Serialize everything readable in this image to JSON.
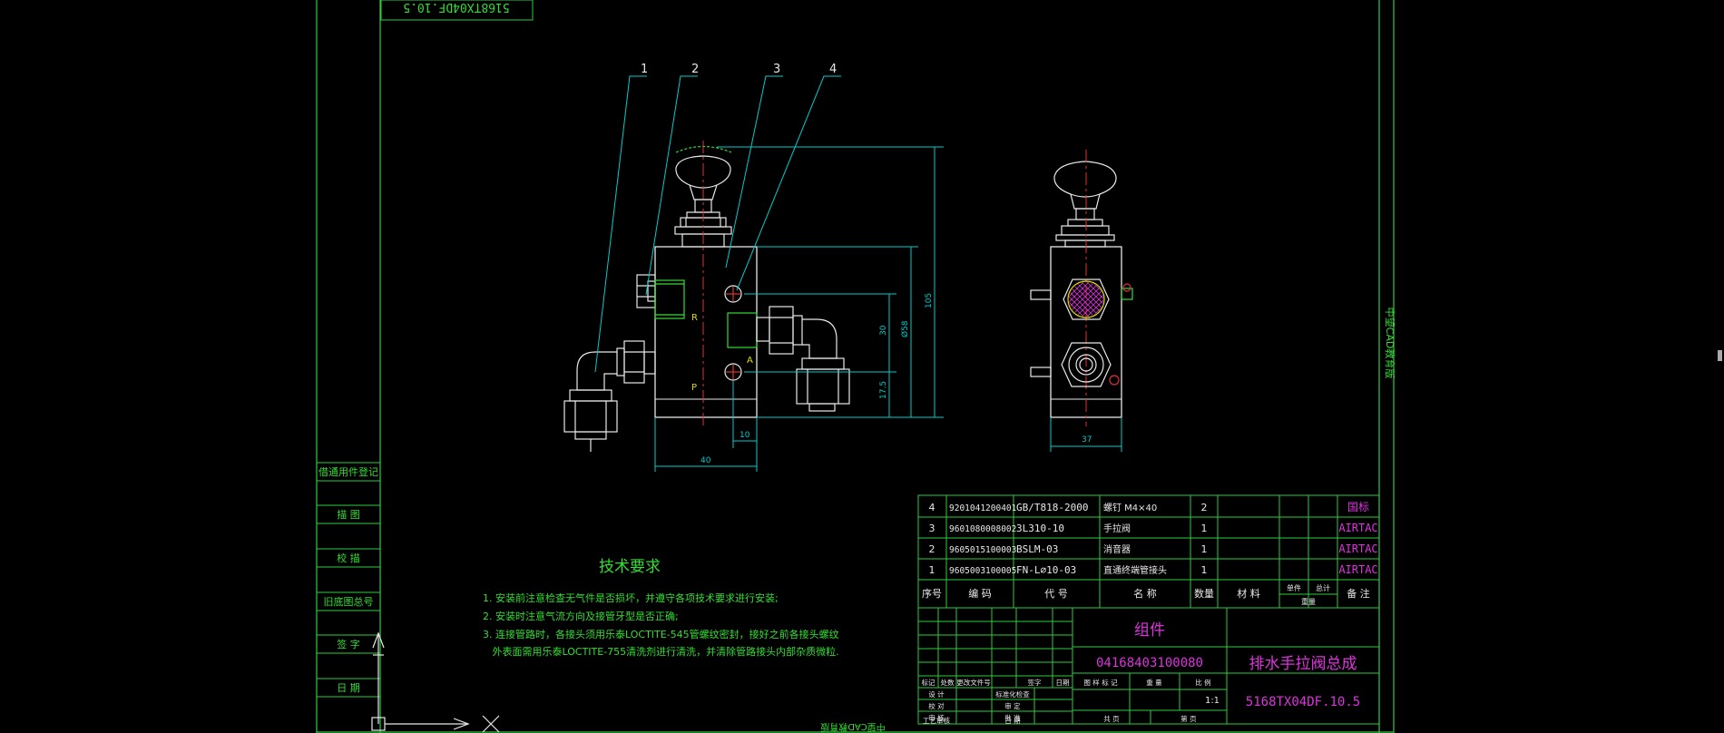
{
  "frame": {
    "top_stamp": "5168TX04DF.10.5",
    "right_strip": "中望CAD教育版",
    "bottom_strip": "中望CAD教育版"
  },
  "left_column": [
    "借通用件登记",
    "描 图",
    "校 描",
    "旧底图总号",
    "签 字",
    "日 期"
  ],
  "balloons": [
    "1",
    "2",
    "3",
    "4"
  ],
  "ports": {
    "r": "R",
    "a": "A",
    "p": "P"
  },
  "dims": {
    "d30": "30",
    "d58": "Ø58",
    "d105": "105",
    "d175": "17.5",
    "d40": "40",
    "d10": "10",
    "d37": "37"
  },
  "tech": {
    "title": "技术要求",
    "lines": [
      "1. 安装前注意检查无气件是否损坏，并遵守各项技术要求进行安装;",
      "2. 安装时注意气流方向及接管牙型是否正确;",
      "3. 连接管路时，各接头须用乐泰LOCTITE-545管螺纹密封，接好之前各接头螺纹",
      "   外表面需用乐泰LOCTITE-755清洗剂进行清洗，并清除管路接头内部杂质微粒."
    ]
  },
  "bom": {
    "rows": [
      {
        "no": "4",
        "code": "9201041200401",
        "spec": "GB/T818-2000",
        "name": "螺钉 M4×40",
        "qty": "2",
        "maker": "国标",
        "side": ""
      },
      {
        "no": "3",
        "code": "9601080008002",
        "spec": "3L310-10",
        "name": "手拉阀",
        "qty": "1",
        "maker": "AIRTAC",
        "side": ""
      },
      {
        "no": "2",
        "code": "9605015100003",
        "spec": "BSLM-03",
        "name": "消音器",
        "qty": "1",
        "maker": "AIRTAC",
        "side": ""
      },
      {
        "no": "1",
        "code": "9605003100005",
        "spec": "FN-L∅10-03",
        "name": "直通终端管接头",
        "qty": "1",
        "maker": "AIRTAC",
        "side": ""
      }
    ],
    "header": [
      "序号",
      "编 码",
      "代 号",
      "名 称",
      "数量",
      "材 料",
      "单件",
      "总计",
      "重量",
      "备 注"
    ]
  },
  "title_block": {
    "type": "组件",
    "drawing_code": "04168403100080",
    "name": "排水手拉阀总成",
    "number": "5168TX04DF.10.5",
    "scale": "1:1",
    "labels": {
      "mark": "标记",
      "count": "处数",
      "change": "更改文件号",
      "sign": "签字",
      "date": "日期",
      "design": "设 计",
      "draw": "校 对",
      "check": "审 核",
      "craft": "工艺审核",
      "std": "标准化检查",
      "review": "审 定",
      "approve": "批 准",
      "date2": "日 期",
      "stage": "图 样 标 记",
      "weight": "重 量",
      "ratio": "比 例",
      "total": "共 页",
      "sheet": "第 页"
    }
  }
}
